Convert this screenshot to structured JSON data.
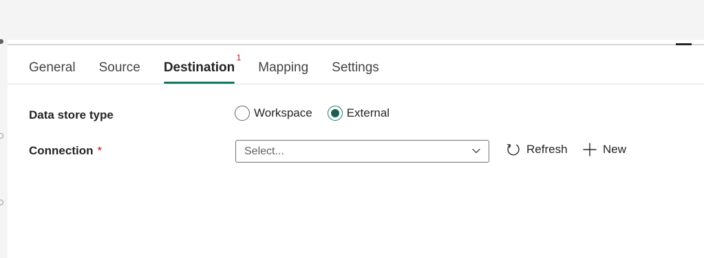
{
  "tabs": [
    {
      "label": "General",
      "active": false
    },
    {
      "label": "Source",
      "active": false
    },
    {
      "label": "Destination",
      "active": true,
      "badge": "1"
    },
    {
      "label": "Mapping",
      "active": false
    },
    {
      "label": "Settings",
      "active": false
    }
  ],
  "form": {
    "data_store_type": {
      "label": "Data store type",
      "options": [
        {
          "label": "Workspace",
          "checked": false
        },
        {
          "label": "External",
          "checked": true
        }
      ]
    },
    "connection": {
      "label": "Connection",
      "required_marker": "*",
      "placeholder": "Select...",
      "refresh_label": "Refresh",
      "new_label": "New"
    }
  },
  "colors": {
    "accent": "#117865",
    "required": "#c50f1f",
    "text": "#242424",
    "chrome": "#f4f4f4"
  },
  "icons": {
    "refresh": "refresh-icon",
    "new": "plus-icon",
    "dropdown": "chevron-down-icon"
  }
}
